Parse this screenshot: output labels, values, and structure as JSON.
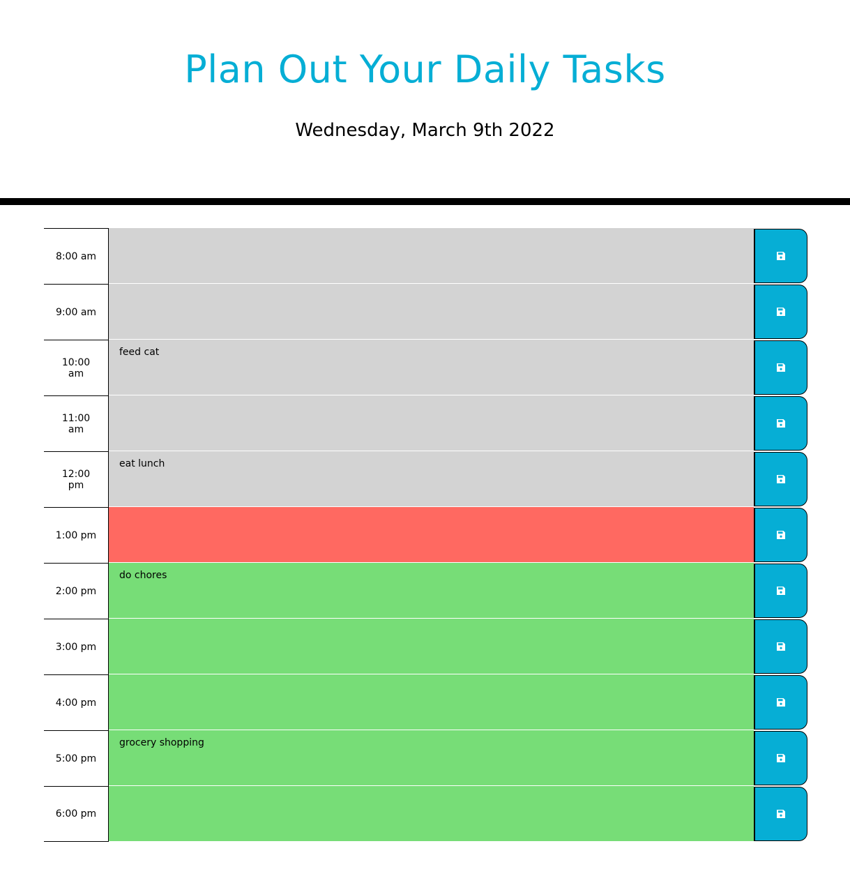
{
  "header": {
    "title": "Plan Out Your Daily Tasks",
    "current_day": "Wednesday, March 9th 2022"
  },
  "colors": {
    "accent": "#06aed5",
    "past": "#d3d3d3",
    "present": "#ff6961",
    "future": "#77dd77"
  },
  "time_blocks": [
    {
      "hour": "8:00 am",
      "task": "",
      "state": "past",
      "save_icon": "floppy-disk-icon"
    },
    {
      "hour": "9:00 am",
      "task": "",
      "state": "past",
      "save_icon": "floppy-disk-icon"
    },
    {
      "hour": "10:00 am",
      "task": "feed cat",
      "state": "past",
      "save_icon": "floppy-disk-icon"
    },
    {
      "hour": "11:00 am",
      "task": "",
      "state": "past",
      "save_icon": "floppy-disk-icon"
    },
    {
      "hour": "12:00 pm",
      "task": "eat lunch",
      "state": "past",
      "save_icon": "floppy-disk-icon"
    },
    {
      "hour": "1:00 pm",
      "task": "",
      "state": "present",
      "save_icon": "floppy-disk-icon"
    },
    {
      "hour": "2:00 pm",
      "task": "do chores",
      "state": "future",
      "save_icon": "floppy-disk-icon"
    },
    {
      "hour": "3:00 pm",
      "task": "",
      "state": "future",
      "save_icon": "floppy-disk-icon"
    },
    {
      "hour": "4:00 pm",
      "task": "",
      "state": "future",
      "save_icon": "floppy-disk-icon"
    },
    {
      "hour": "5:00 pm",
      "task": "grocery shopping",
      "state": "future",
      "save_icon": "floppy-disk-icon"
    },
    {
      "hour": "6:00 pm",
      "task": "",
      "state": "future",
      "save_icon": "floppy-disk-icon"
    }
  ]
}
